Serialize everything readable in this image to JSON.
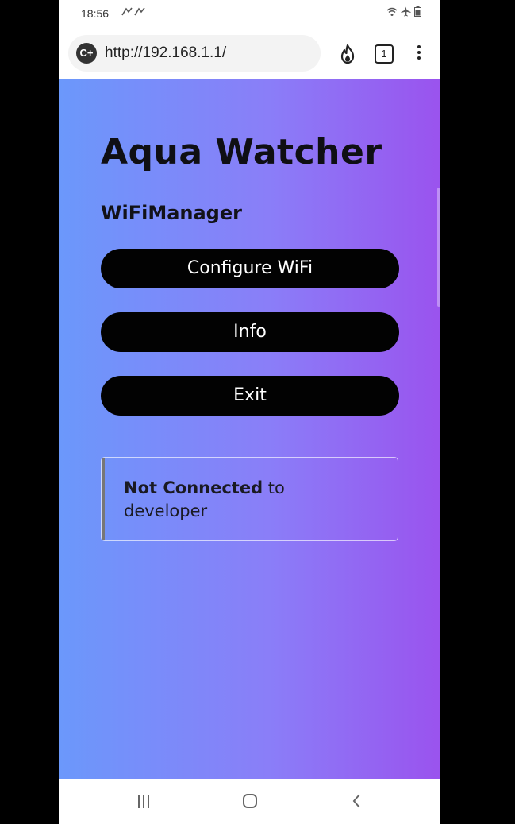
{
  "status_bar": {
    "time": "18:56",
    "left_icons": "notification-icons",
    "right_icons": [
      "wifi-icon",
      "airplane-icon",
      "battery-icon"
    ]
  },
  "browser": {
    "url": "http://192.168.1.1/",
    "tab_count": "1",
    "site_icon_glyph": "C+"
  },
  "page": {
    "title": "Aqua Watcher",
    "subtitle": "WiFiManager",
    "buttons": {
      "configure": "Configure WiFi",
      "info": "Info",
      "exit": "Exit"
    },
    "status": {
      "state": "Not Connected",
      "connector": " to",
      "ssid": "developer"
    },
    "gradient": {
      "start": "#6b98fb",
      "end": "#9a53ee"
    }
  }
}
